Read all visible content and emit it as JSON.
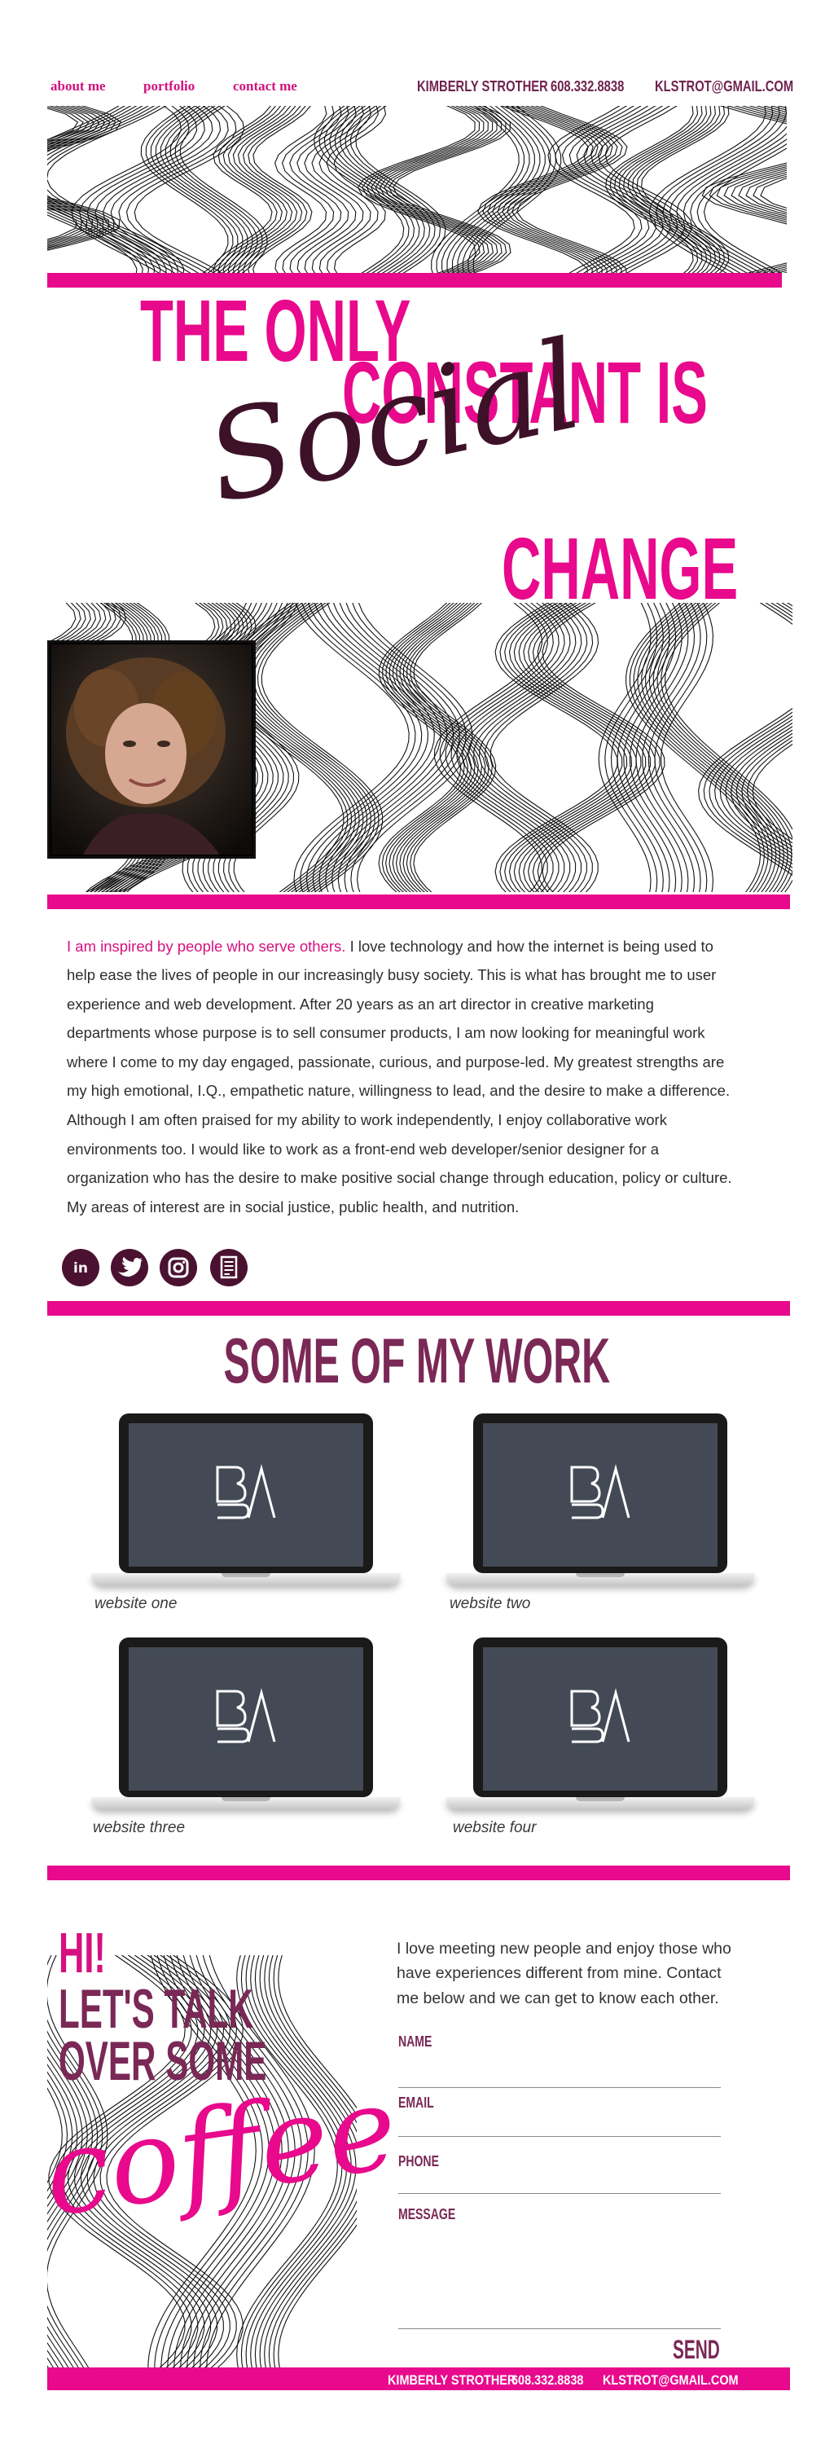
{
  "nav": {
    "links": [
      "about me",
      "portfolio",
      "contact me"
    ]
  },
  "contact_info": {
    "name": "KIMBERLY STROTHER",
    "phone": "608.332.8838",
    "email": "KLSTROT@GMAIL.COM"
  },
  "hero": {
    "line1": "THE ONLY",
    "line2": "CONSTANT IS",
    "script_word": "Social",
    "line3": "CHANGE"
  },
  "bio": {
    "lead": "I am inspired by people who serve others.",
    "body": " I love technology and how the internet is being used to help ease the lives of people in our increasingly busy society. This is what has brought me to user experience and web development. After 20 years as an art director in creative marketing departments whose purpose is to sell consumer products, I am now looking for meaningful work where I come to my day engaged, passionate, curious, and purpose-led. My greatest strengths are my high emotional, I.Q., empathetic nature, willingness to lead, and the desire to make a difference. Although I am often praised for my ability to work independently, I enjoy collaborative work environments too. I would like to work as a front-end web developer/senior designer for a organization who has the desire to make positive social change through education, policy or culture. My areas of interest are in social justice, public health, and nutrition."
  },
  "social_icons": [
    "linkedin-icon",
    "twitter-icon",
    "instagram-icon",
    "resume-icon"
  ],
  "work": {
    "heading": "SOME OF MY WORK",
    "items": [
      {
        "caption": "website one"
      },
      {
        "caption": "website two"
      },
      {
        "caption": "website three"
      },
      {
        "caption": "website four"
      }
    ]
  },
  "contact": {
    "hi": "HI!",
    "talk1": "LET'S TALK",
    "talk2": "OVER SOME",
    "script_word": "coffee",
    "intro": "I love meeting new people and enjoy those who have experiences different from mine. Contact me below and we can get to know each other.",
    "fields": [
      "NAME",
      "EMAIL",
      "PHONE",
      "MESSAGE"
    ],
    "send": "SEND"
  },
  "colors": {
    "accent": "#e8098c",
    "plum": "#7a2856",
    "dark_plum": "#3d1228"
  }
}
